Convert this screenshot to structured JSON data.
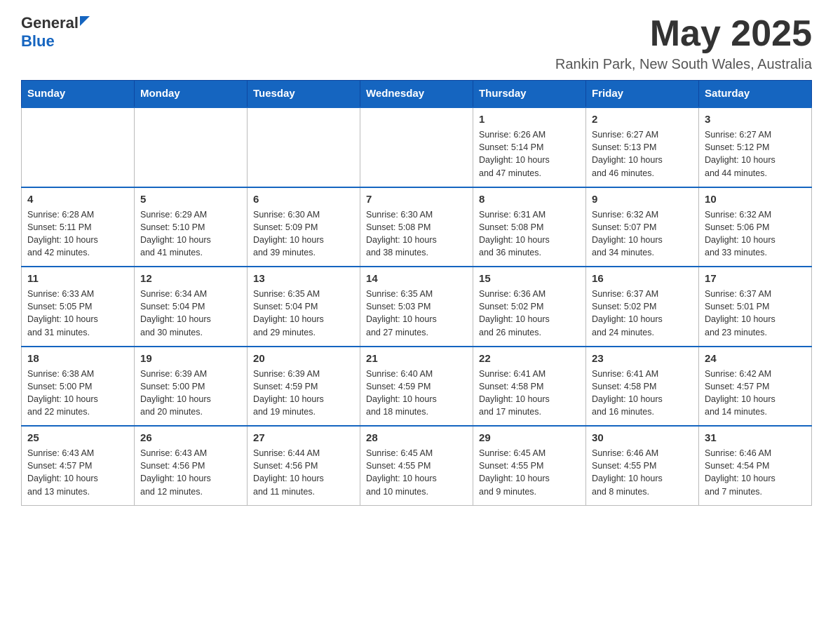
{
  "header": {
    "logo_general": "General",
    "logo_blue": "Blue",
    "month_title": "May 2025",
    "location": "Rankin Park, New South Wales, Australia"
  },
  "days_of_week": [
    "Sunday",
    "Monday",
    "Tuesday",
    "Wednesday",
    "Thursday",
    "Friday",
    "Saturday"
  ],
  "weeks": [
    {
      "cells": [
        {
          "day": "",
          "info": ""
        },
        {
          "day": "",
          "info": ""
        },
        {
          "day": "",
          "info": ""
        },
        {
          "day": "",
          "info": ""
        },
        {
          "day": "1",
          "info": "Sunrise: 6:26 AM\nSunset: 5:14 PM\nDaylight: 10 hours\nand 47 minutes."
        },
        {
          "day": "2",
          "info": "Sunrise: 6:27 AM\nSunset: 5:13 PM\nDaylight: 10 hours\nand 46 minutes."
        },
        {
          "day": "3",
          "info": "Sunrise: 6:27 AM\nSunset: 5:12 PM\nDaylight: 10 hours\nand 44 minutes."
        }
      ]
    },
    {
      "cells": [
        {
          "day": "4",
          "info": "Sunrise: 6:28 AM\nSunset: 5:11 PM\nDaylight: 10 hours\nand 42 minutes."
        },
        {
          "day": "5",
          "info": "Sunrise: 6:29 AM\nSunset: 5:10 PM\nDaylight: 10 hours\nand 41 minutes."
        },
        {
          "day": "6",
          "info": "Sunrise: 6:30 AM\nSunset: 5:09 PM\nDaylight: 10 hours\nand 39 minutes."
        },
        {
          "day": "7",
          "info": "Sunrise: 6:30 AM\nSunset: 5:08 PM\nDaylight: 10 hours\nand 38 minutes."
        },
        {
          "day": "8",
          "info": "Sunrise: 6:31 AM\nSunset: 5:08 PM\nDaylight: 10 hours\nand 36 minutes."
        },
        {
          "day": "9",
          "info": "Sunrise: 6:32 AM\nSunset: 5:07 PM\nDaylight: 10 hours\nand 34 minutes."
        },
        {
          "day": "10",
          "info": "Sunrise: 6:32 AM\nSunset: 5:06 PM\nDaylight: 10 hours\nand 33 minutes."
        }
      ]
    },
    {
      "cells": [
        {
          "day": "11",
          "info": "Sunrise: 6:33 AM\nSunset: 5:05 PM\nDaylight: 10 hours\nand 31 minutes."
        },
        {
          "day": "12",
          "info": "Sunrise: 6:34 AM\nSunset: 5:04 PM\nDaylight: 10 hours\nand 30 minutes."
        },
        {
          "day": "13",
          "info": "Sunrise: 6:35 AM\nSunset: 5:04 PM\nDaylight: 10 hours\nand 29 minutes."
        },
        {
          "day": "14",
          "info": "Sunrise: 6:35 AM\nSunset: 5:03 PM\nDaylight: 10 hours\nand 27 minutes."
        },
        {
          "day": "15",
          "info": "Sunrise: 6:36 AM\nSunset: 5:02 PM\nDaylight: 10 hours\nand 26 minutes."
        },
        {
          "day": "16",
          "info": "Sunrise: 6:37 AM\nSunset: 5:02 PM\nDaylight: 10 hours\nand 24 minutes."
        },
        {
          "day": "17",
          "info": "Sunrise: 6:37 AM\nSunset: 5:01 PM\nDaylight: 10 hours\nand 23 minutes."
        }
      ]
    },
    {
      "cells": [
        {
          "day": "18",
          "info": "Sunrise: 6:38 AM\nSunset: 5:00 PM\nDaylight: 10 hours\nand 22 minutes."
        },
        {
          "day": "19",
          "info": "Sunrise: 6:39 AM\nSunset: 5:00 PM\nDaylight: 10 hours\nand 20 minutes."
        },
        {
          "day": "20",
          "info": "Sunrise: 6:39 AM\nSunset: 4:59 PM\nDaylight: 10 hours\nand 19 minutes."
        },
        {
          "day": "21",
          "info": "Sunrise: 6:40 AM\nSunset: 4:59 PM\nDaylight: 10 hours\nand 18 minutes."
        },
        {
          "day": "22",
          "info": "Sunrise: 6:41 AM\nSunset: 4:58 PM\nDaylight: 10 hours\nand 17 minutes."
        },
        {
          "day": "23",
          "info": "Sunrise: 6:41 AM\nSunset: 4:58 PM\nDaylight: 10 hours\nand 16 minutes."
        },
        {
          "day": "24",
          "info": "Sunrise: 6:42 AM\nSunset: 4:57 PM\nDaylight: 10 hours\nand 14 minutes."
        }
      ]
    },
    {
      "cells": [
        {
          "day": "25",
          "info": "Sunrise: 6:43 AM\nSunset: 4:57 PM\nDaylight: 10 hours\nand 13 minutes."
        },
        {
          "day": "26",
          "info": "Sunrise: 6:43 AM\nSunset: 4:56 PM\nDaylight: 10 hours\nand 12 minutes."
        },
        {
          "day": "27",
          "info": "Sunrise: 6:44 AM\nSunset: 4:56 PM\nDaylight: 10 hours\nand 11 minutes."
        },
        {
          "day": "28",
          "info": "Sunrise: 6:45 AM\nSunset: 4:55 PM\nDaylight: 10 hours\nand 10 minutes."
        },
        {
          "day": "29",
          "info": "Sunrise: 6:45 AM\nSunset: 4:55 PM\nDaylight: 10 hours\nand 9 minutes."
        },
        {
          "day": "30",
          "info": "Sunrise: 6:46 AM\nSunset: 4:55 PM\nDaylight: 10 hours\nand 8 minutes."
        },
        {
          "day": "31",
          "info": "Sunrise: 6:46 AM\nSunset: 4:54 PM\nDaylight: 10 hours\nand 7 minutes."
        }
      ]
    }
  ]
}
